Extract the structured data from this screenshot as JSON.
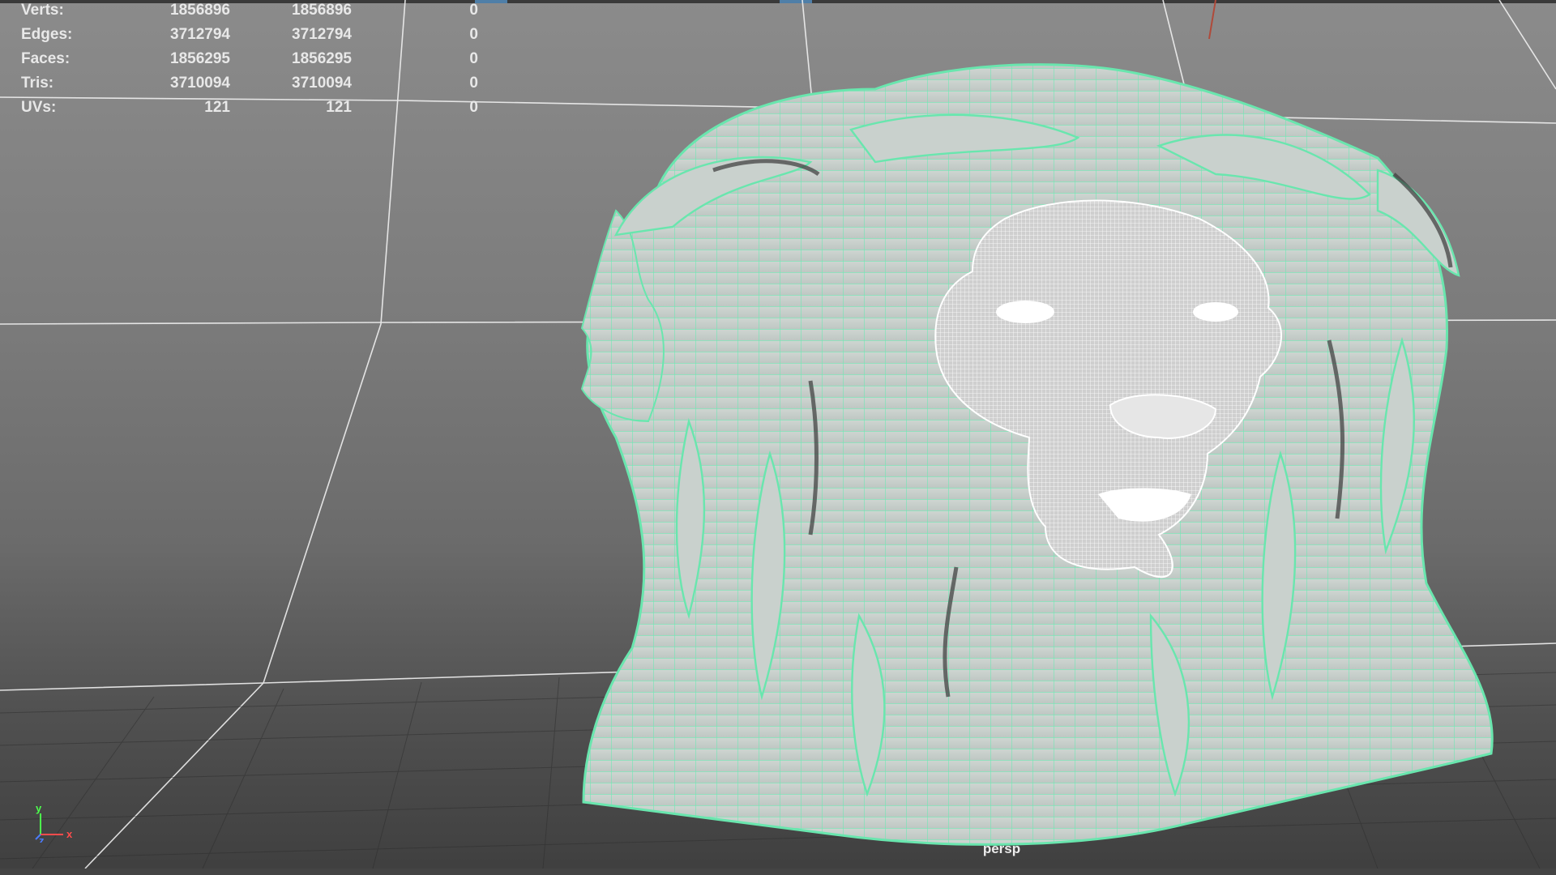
{
  "viewport": {
    "camera_label": "persp",
    "background_top": "#8b8b8b",
    "background_bottom": "#3f3f3f",
    "grid_color": "#ffffff",
    "wire_color": "#7af0c0",
    "mesh_color": "#d8d8d8"
  },
  "heads_up_display": {
    "rows": [
      {
        "label": "Verts:",
        "total": "1856896",
        "selected": "1856896",
        "component": "0"
      },
      {
        "label": "Edges:",
        "total": "3712794",
        "selected": "3712794",
        "component": "0"
      },
      {
        "label": "Faces:",
        "total": "1856295",
        "selected": "1856295",
        "component": "0"
      },
      {
        "label": "Tris:",
        "total": "3710094",
        "selected": "3710094",
        "component": "0"
      },
      {
        "label": "UVs:",
        "total": "121",
        "selected": "121",
        "component": "0"
      }
    ]
  },
  "axis_gizmo": {
    "y": "y",
    "z": "z",
    "x": "x",
    "y_color": "#4cff4c",
    "z_color": "#4c7cff",
    "x_color": "#ff4c4c"
  },
  "model": {
    "name_icon": "lion-bust-mesh-icon"
  }
}
